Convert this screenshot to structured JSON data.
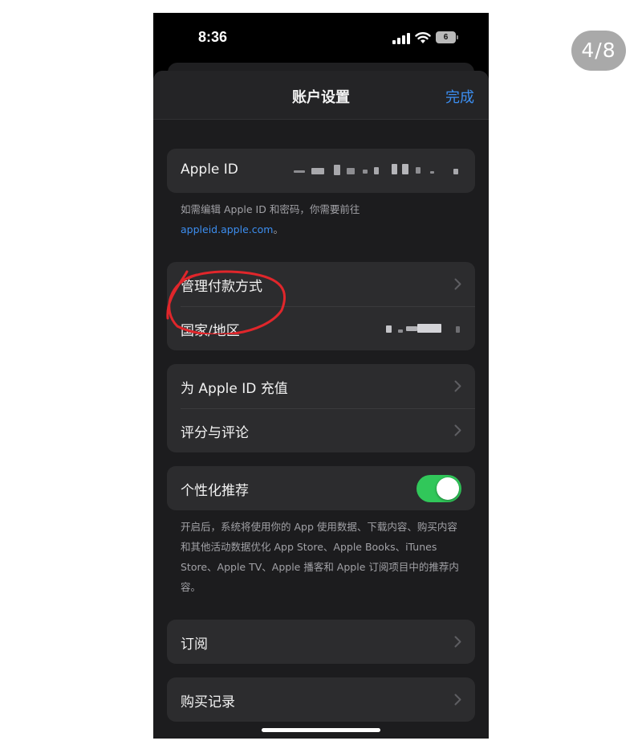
{
  "page_counter": "4/8",
  "status_bar": {
    "time": "8:36",
    "battery_level": "6"
  },
  "nav": {
    "title": "账户设置",
    "done_label": "完成"
  },
  "apple_id": {
    "label": "Apple ID",
    "note_prefix": "如需编辑 Apple ID 和密码，你需要前往",
    "note_link": "appleid.apple.com",
    "note_suffix": "。"
  },
  "account_rows": [
    {
      "label": "管理付款方式"
    },
    {
      "label": "国家/地区"
    }
  ],
  "misc_rows": [
    {
      "label": "为 Apple ID 充值"
    },
    {
      "label": "评分与评论"
    }
  ],
  "personalization": {
    "label": "个性化推荐",
    "enabled": true,
    "note": "开启后，系统将使用你的 App 使用数据、下载内容、购买内容和其他活动数据优化 App Store、Apple Books、iTunes Store、Apple TV、Apple 播客和 Apple 订阅项目中的推荐内容。"
  },
  "subscriptions": {
    "label": "订阅"
  },
  "purchase_history": {
    "label": "购买记录"
  },
  "colors": {
    "accent": "#3c8ef0",
    "toggle_on": "#31c75a",
    "annotation": "#e0262b",
    "cell_background": "#2c2c2e",
    "sheet_background": "#1c1c1e"
  }
}
